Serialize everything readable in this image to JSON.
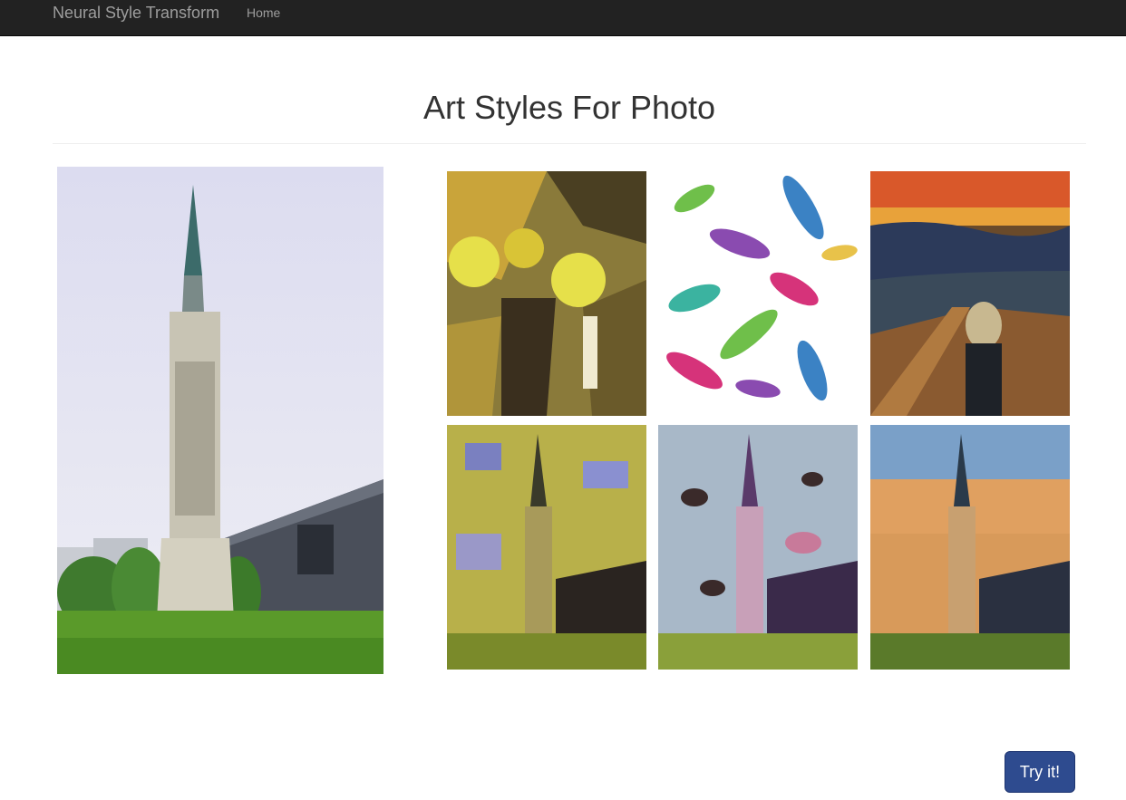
{
  "navbar": {
    "brand": "Neural Style Transform",
    "links": [
      "Home"
    ]
  },
  "page": {
    "title": "Art Styles For Photo"
  },
  "content_photo": {
    "subject": "tall tower with buildings and grass"
  },
  "style_images": [
    {
      "name": "cubist-style-image",
      "palette": [
        "#c9a43a",
        "#e6e04a",
        "#3a2f1e",
        "#8a7a3a"
      ]
    },
    {
      "name": "watercolor-feathers-style-image",
      "palette": [
        "#ffffff",
        "#3b82c4",
        "#d6337a",
        "#6fbf4a",
        "#8a4bb0"
      ]
    },
    {
      "name": "the-scream-style-image",
      "palette": [
        "#d9582a",
        "#e8a23a",
        "#2c3a5a",
        "#6a4a2a"
      ]
    }
  ],
  "stylized_results": [
    {
      "name": "cubist-stylized-tower"
    },
    {
      "name": "feather-stylized-tower"
    },
    {
      "name": "scream-stylized-tower"
    }
  ],
  "actions": {
    "try_label": "Try it!"
  },
  "colors": {
    "navbar_bg": "#222222",
    "navbar_text": "#9d9d9d",
    "button_bg": "#2e4b8f",
    "title_text": "#333333"
  }
}
